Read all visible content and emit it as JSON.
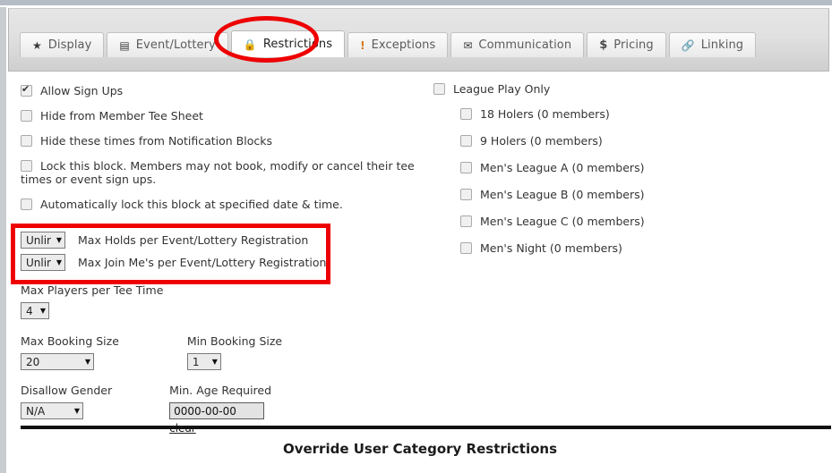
{
  "window": {
    "accent_red": "#ee0000",
    "tabbar_bg": "#e0e0e0",
    "top_strip_color": "#b6bcc6"
  },
  "tabs": [
    {
      "label": "Display",
      "icon": "star-icon",
      "glyph": "★",
      "active": false
    },
    {
      "label": "Event/Lottery",
      "icon": "calendar-icon",
      "glyph": "▤",
      "active": false
    },
    {
      "label": "Restrictions",
      "icon": "lock-icon",
      "glyph": "🔒",
      "active": true
    },
    {
      "label": "Exceptions",
      "icon": "exclamation-icon",
      "glyph": "!",
      "active": false
    },
    {
      "label": "Communication",
      "icon": "envelope-icon",
      "glyph": "✉",
      "active": false
    },
    {
      "label": "Pricing",
      "icon": "dollar-icon",
      "glyph": "$",
      "active": false
    },
    {
      "label": "Linking",
      "icon": "link-icon",
      "glyph": "🔗",
      "active": false
    }
  ],
  "left_column": {
    "checkboxes": [
      {
        "label": "Allow Sign Ups",
        "checked": true
      },
      {
        "label": "Hide from Member Tee Sheet",
        "checked": false
      },
      {
        "label": "Hide these times from Notification Blocks",
        "checked": false
      },
      {
        "label": "Lock this block. Members may not book, modify or cancel their tee times or event sign ups.",
        "checked": false
      },
      {
        "label": "Automatically lock this block at specified date & time.",
        "checked": false
      }
    ],
    "registration_limits": [
      {
        "value": "Unlir",
        "label": "Max Holds per Event/Lottery Registration"
      },
      {
        "value": "Unlir",
        "label": "Max Join Me's per Event/Lottery Registration"
      }
    ],
    "max_players_label": "Max Players per Tee Time",
    "max_players_value": "4",
    "max_booking_label": "Max Booking Size",
    "max_booking_value": "20",
    "min_booking_label": "Min Booking Size",
    "min_booking_value": "1",
    "disallow_gender_label": "Disallow Gender",
    "disallow_gender_value": "N/A",
    "min_age_label": "Min. Age Required",
    "min_age_value": "0000-00-00",
    "clear_label": "clear"
  },
  "right_column": {
    "league_play_only": {
      "label": "League Play Only",
      "checked": false
    },
    "leagues": [
      {
        "label": "18 Holers (0 members)",
        "checked": false
      },
      {
        "label": "9 Holers (0 members)",
        "checked": false
      },
      {
        "label": "Men's League A (0 members)",
        "checked": false
      },
      {
        "label": "Men's League B (0 members)",
        "checked": false
      },
      {
        "label": "Men's League C (0 members)",
        "checked": false
      },
      {
        "label": "Men's Night (0 members)",
        "checked": false
      }
    ]
  },
  "footer": {
    "override_title": "Override User Category Restrictions"
  }
}
